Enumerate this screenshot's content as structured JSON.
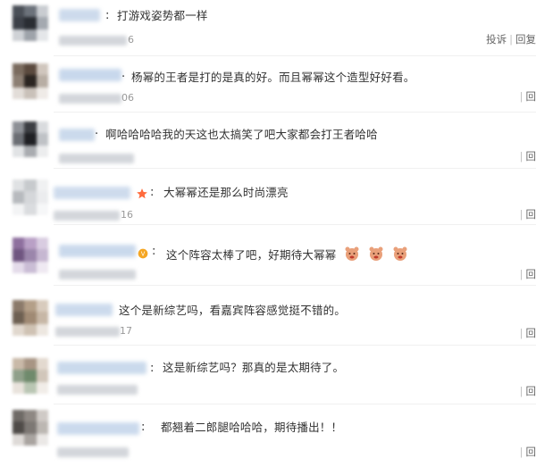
{
  "comments": [
    {
      "text": "打游戏姿势都一样",
      "time_tail": "6",
      "actions": {
        "report": "投诉",
        "reply": "回复"
      },
      "avatar_colors": [
        "#4a4f57",
        "#6c727b",
        "#c9ccd1",
        "#3c4048",
        "#2a2d33",
        "#a4a9b0",
        "#cfd2d6",
        "#9ea3aa",
        "#e4e6e9"
      ],
      "name_color": "#c8d7ea"
    },
    {
      "text": "杨幂的王者是打的是真的好。而且幂幂这个造型好好看。",
      "time_tail": "06",
      "actions": {
        "reply": "回"
      },
      "avatar_colors": [
        "#7a6b5e",
        "#5b4a3e",
        "#d0c6bd",
        "#8c7f73",
        "#2b2521",
        "#b8aea4",
        "#e2ddd8",
        "#c9c1b9",
        "#efebe7"
      ],
      "name_color": "#c3d4ea"
    },
    {
      "text": "啊哈哈哈哈我的天这也太搞笑了吧大家都会打王者哈哈",
      "time_tail": "",
      "actions": {
        "reply": "回"
      },
      "avatar_colors": [
        "#8d9096",
        "#3b3d42",
        "#d9dbde",
        "#6b6e74",
        "#1f2024",
        "#bfc2c6",
        "#e1e3e5",
        "#a9acb0",
        "#ecedee"
      ],
      "name_color": "#c6d6ea"
    },
    {
      "text": "大幂幂还是那么时尚漂亮",
      "time_tail": "16",
      "actions": {
        "reply": "回"
      },
      "avatar_colors": [
        "#e0e2e4",
        "#c7cacd",
        "#f0f1f2",
        "#b7babe",
        "#d5d7da",
        "#ebecee",
        "#f3f4f5",
        "#dadcdf",
        "#f6f7f8"
      ],
      "name_color": "#c9d8eb"
    },
    {
      "text": "这个阵容太棒了吧，好期待大幂幂",
      "time_tail": "",
      "actions": {
        "reply": "回"
      },
      "avatar_colors": [
        "#8e6f9e",
        "#b9a0c6",
        "#d9cce1",
        "#6f5580",
        "#9b86ab",
        "#c6b7d1",
        "#e4dbea",
        "#cabdd5",
        "#efe9f2"
      ],
      "name_color": "#c4d5ea"
    },
    {
      "text": "这个是新综艺吗，看嘉宾阵容感觉挺不错的。",
      "time_tail": "17",
      "actions": {
        "reply": "回"
      },
      "avatar_colors": [
        "#8b7a6a",
        "#b49f88",
        "#d8cbbd",
        "#6e6052",
        "#a08a74",
        "#c7b7a6",
        "#e1d8ce",
        "#cfc2b3",
        "#ede7e0"
      ],
      "name_color": "#c7d7eb"
    },
    {
      "text": "这是新综艺吗？那真的是太期待了。",
      "time_tail": "",
      "actions": {
        "reply": "回"
      },
      "avatar_colors": [
        "#c9b9a8",
        "#a89584",
        "#e3d9cf",
        "#8fa08a",
        "#6f8a6c",
        "#d1c6ba",
        "#e9e3dc",
        "#b9c6b3",
        "#f1ede8"
      ],
      "name_color": "#c5d6ea"
    },
    {
      "text": "都翘着二郎腿哈哈哈，期待播出！！",
      "time_tail": "",
      "actions": {
        "reply": "回"
      },
      "avatar_colors": [
        "#6f6a66",
        "#8e8883",
        "#cfcac6",
        "#4f4b48",
        "#7d7874",
        "#bcb7b2",
        "#dedad7",
        "#a9a4a0",
        "#ebe8e6"
      ],
      "name_color": "#c6d6eb"
    }
  ]
}
